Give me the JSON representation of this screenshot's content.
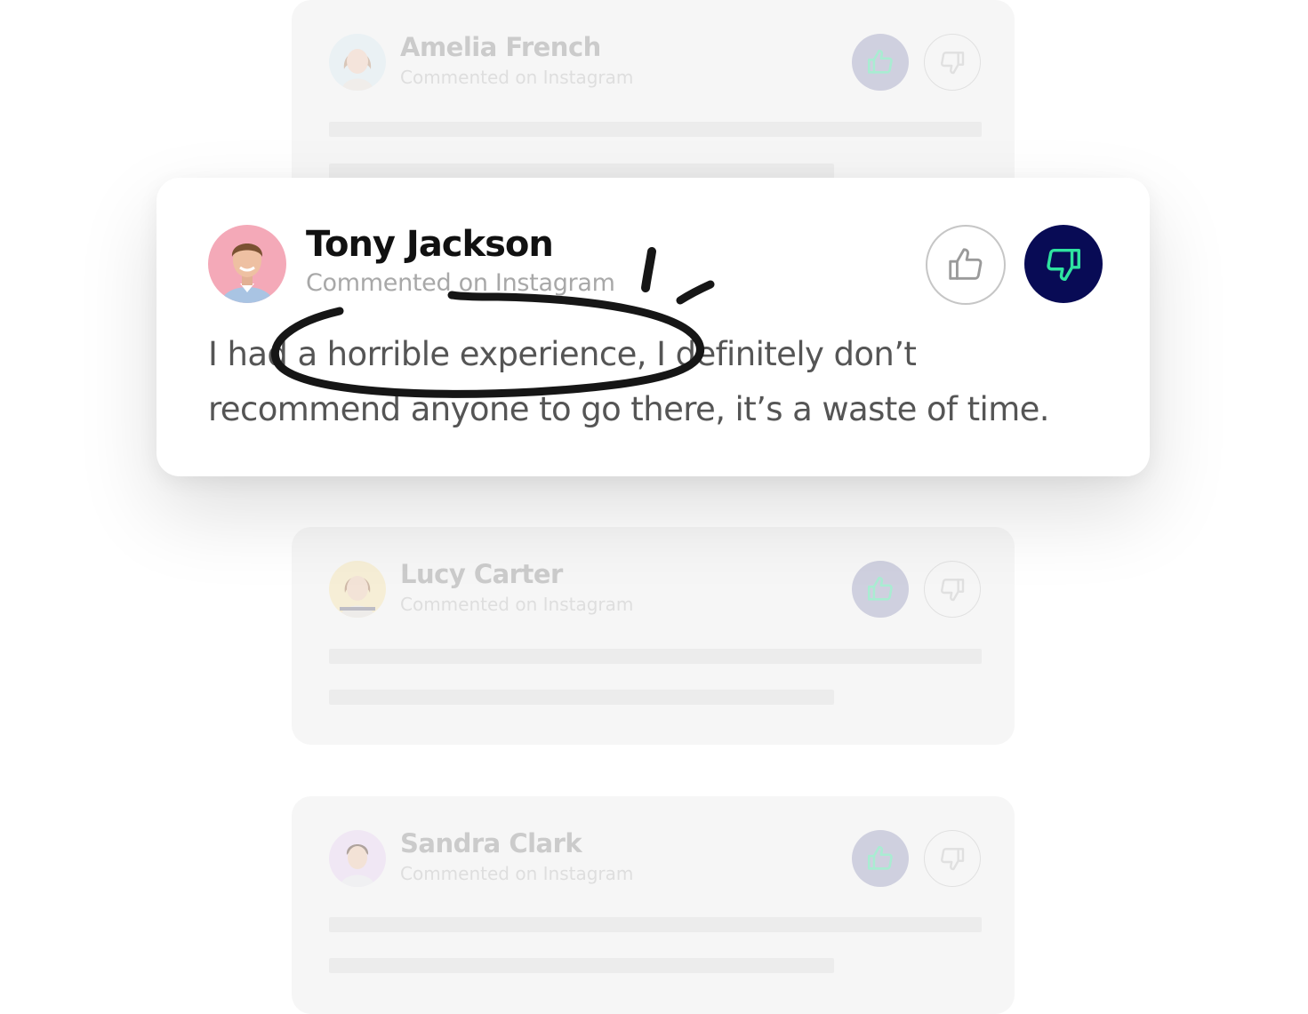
{
  "background_comments": [
    {
      "name": "Amelia French",
      "subtitle": "Commented on Instagram",
      "avatar_color": "#dcebf3",
      "avatar": "avatar-amelia"
    },
    {
      "name": "Lucy Carter",
      "subtitle": "Commented on Instagram",
      "avatar_color": "#f7e6b0",
      "avatar": "avatar-lucy"
    },
    {
      "name": "Sandra Clark",
      "subtitle": "Commented on Instagram",
      "avatar_color": "#ead7f2",
      "avatar": "avatar-sandra"
    }
  ],
  "featured_comment": {
    "name": "Tony Jackson",
    "subtitle": "Commented on Instagram",
    "body_line1": "I had a horrible experience, I definitely don’t",
    "body_line2": "recommend anyone to go there, it’s a waste of time.",
    "avatar_color": "#f4a9b8",
    "like_icon": "thumbs-up-icon",
    "dislike_icon": "thumbs-down-icon",
    "dislike_selected": true
  },
  "colors": {
    "accent_navy": "#080b55",
    "accent_green": "#2fe3a0",
    "card_bg": "#f6f6f6"
  }
}
